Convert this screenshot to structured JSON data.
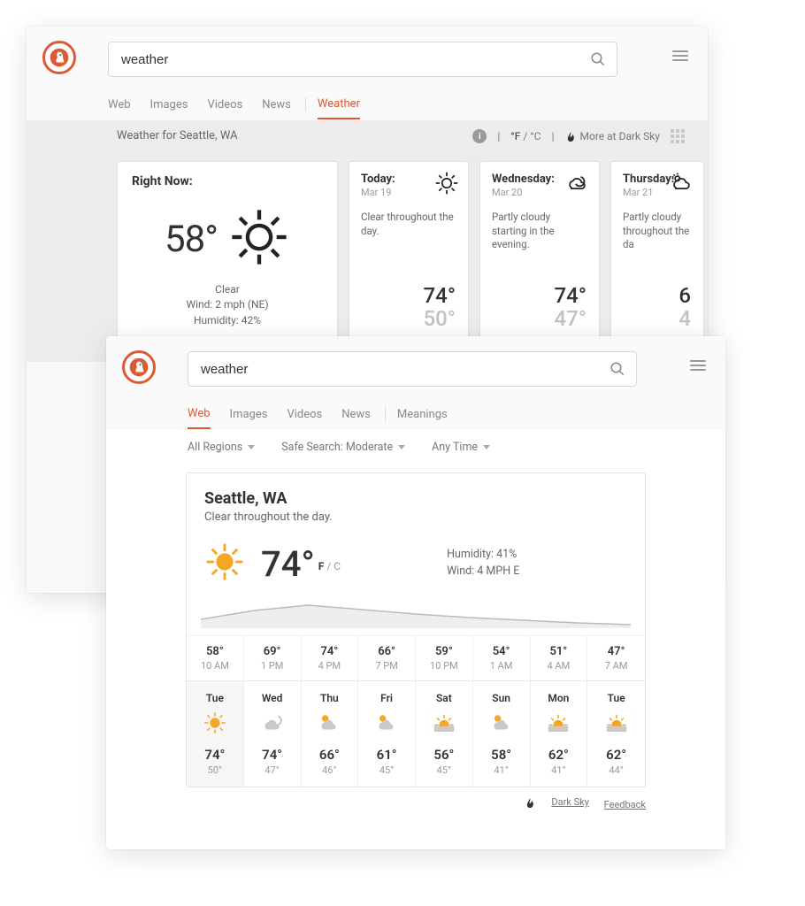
{
  "search_query": "weather",
  "card1": {
    "tabs": [
      "Web",
      "Images",
      "Videos",
      "News",
      "Weather"
    ],
    "active_tab": "Weather",
    "heading": "Weather for Seattle, WA",
    "unit_f": "°F",
    "unit_c": "°C",
    "more_link": "More at Dark Sky",
    "now": {
      "label": "Right Now:",
      "temp": "58°",
      "condition": "Clear",
      "wind": "Wind: 2 mph (NE)",
      "humidity": "Humidity: 42%"
    },
    "forecast": [
      {
        "title": "Today:",
        "date": "Mar 19",
        "desc": "Clear throughout the day.",
        "hi": "74°",
        "lo": "50°",
        "icon": "sun"
      },
      {
        "title": "Wednesday:",
        "date": "Mar 20",
        "desc": "Partly cloudy starting in the evening.",
        "hi": "74°",
        "lo": "47°",
        "icon": "cloud-moon"
      },
      {
        "title": "Thursday:",
        "date": "Mar 21",
        "desc": "Partly cloudy throughout the da",
        "hi": "6",
        "lo": "4",
        "icon": "cloud-sun"
      }
    ]
  },
  "card2": {
    "tabs": [
      "Web",
      "Images",
      "Videos",
      "News",
      "Meanings"
    ],
    "active_tab": "Web",
    "filters": {
      "region": "All Regions",
      "safe": "Safe Search: Moderate",
      "time": "Any Time"
    },
    "location": "Seattle, WA",
    "summary": "Clear throughout the day.",
    "temp": "74°",
    "unit_f": "F",
    "unit_c": "C",
    "humidity": "Humidity: 41%",
    "wind": "Wind: 4 MPH E",
    "hours": [
      {
        "t": "58°",
        "h": "10 AM"
      },
      {
        "t": "69°",
        "h": "1 PM"
      },
      {
        "t": "74°",
        "h": "4 PM"
      },
      {
        "t": "66°",
        "h": "7 PM"
      },
      {
        "t": "59°",
        "h": "10 PM"
      },
      {
        "t": "54°",
        "h": "1 AM"
      },
      {
        "t": "51°",
        "h": "4 AM"
      },
      {
        "t": "47°",
        "h": "7 AM"
      }
    ],
    "days": [
      {
        "name": "Tue",
        "hi": "74°",
        "lo": "50°",
        "icon": "sun",
        "selected": true
      },
      {
        "name": "Wed",
        "hi": "74°",
        "lo": "47°",
        "icon": "cloud-moon"
      },
      {
        "name": "Thu",
        "hi": "66°",
        "lo": "46°",
        "icon": "cloud-sun-grey"
      },
      {
        "name": "Fri",
        "hi": "61°",
        "lo": "45°",
        "icon": "cloud-sun-grey"
      },
      {
        "name": "Sat",
        "hi": "56°",
        "lo": "45°",
        "icon": "sunrise"
      },
      {
        "name": "Sun",
        "hi": "58°",
        "lo": "41°",
        "icon": "cloud-sun-grey"
      },
      {
        "name": "Mon",
        "hi": "62°",
        "lo": "41°",
        "icon": "sunrise"
      },
      {
        "name": "Tue",
        "hi": "62°",
        "lo": "44°",
        "icon": "sunrise"
      }
    ],
    "footer": {
      "darksky": "Dark Sky",
      "feedback": "Feedback"
    }
  }
}
